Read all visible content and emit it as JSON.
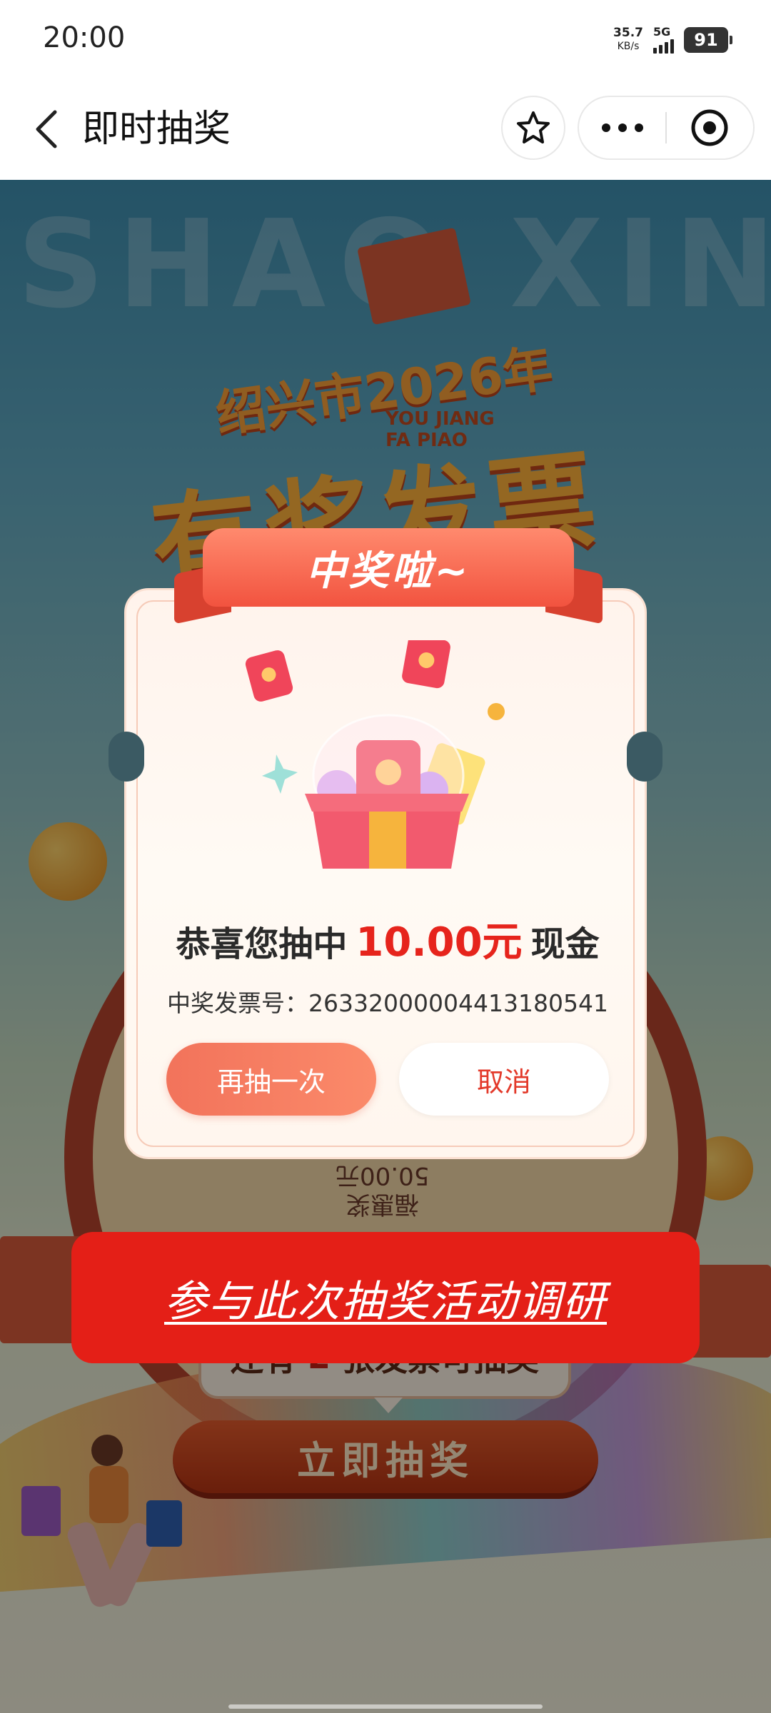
{
  "status_bar": {
    "time": "20:00",
    "net_speed_value": "35.7",
    "net_speed_unit": "KB/s",
    "network_type": "5G",
    "battery_level": "91"
  },
  "nav": {
    "title": "即时抽奖",
    "icons": {
      "back": "chevron-left-icon",
      "favorite": "star-icon",
      "more": "more-horizontal-icon",
      "close": "target-close-icon"
    }
  },
  "background": {
    "wordmark": "SHAO XING",
    "logo_line1": "绍兴市2026年",
    "logo_sub_line1": "YOU JIANG",
    "logo_sub_line2": "FA PIAO",
    "logo_main": "有奖发票",
    "wheel_prize_line1": "50.00元",
    "wheel_prize_line2": "福惠奖",
    "remaining_prefix": "还有",
    "remaining_count": "2",
    "remaining_suffix": "张发票可抽奖",
    "draw_now_label": "立即抽奖"
  },
  "dialog": {
    "ribbon_title": "中奖啦~",
    "congrats_prefix": "恭喜您抽中",
    "prize_amount": "10.00元",
    "congrats_suffix": "现金",
    "invoice_line": "中奖发票号：26332000004413180541",
    "again_button": "再抽一次",
    "cancel_button": "取消"
  },
  "survey": {
    "link_label": "参与此次抽奖活动调研"
  },
  "colors": {
    "accent_red": "#e41f17",
    "prize_red": "#e6241c",
    "ribbon": "#f2533f",
    "again_button": "#f2735b"
  }
}
